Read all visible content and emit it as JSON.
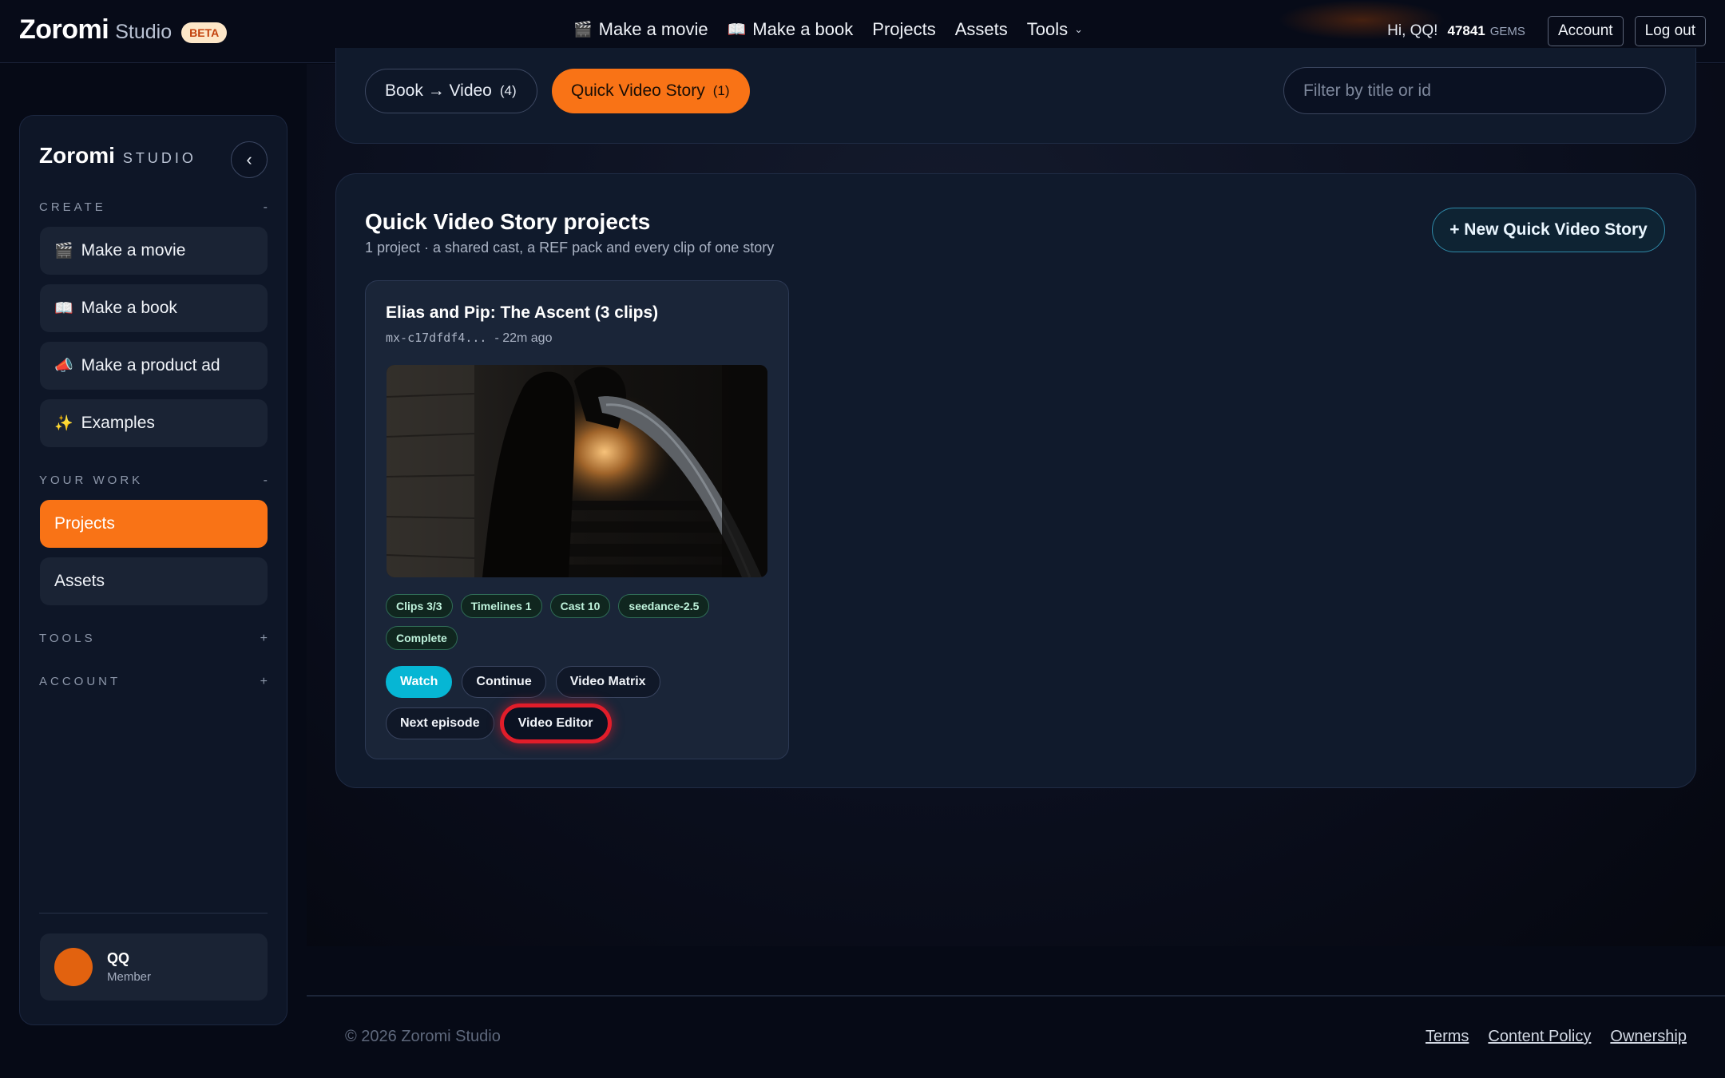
{
  "header": {
    "brand": "Zoromi",
    "brand_sub": "Studio",
    "beta": "BETA",
    "nav": [
      {
        "label": "Make a movie",
        "icon": "🎬"
      },
      {
        "label": "Make a book",
        "icon": "📖"
      },
      {
        "label": "Projects"
      },
      {
        "label": "Assets"
      },
      {
        "label": "Tools"
      }
    ],
    "greeting": "Hi, QQ!",
    "gems_count": "47841",
    "gems_label": "GEMS",
    "account_label": "Account",
    "logout_label": "Log out"
  },
  "sidebar": {
    "brand": "Zoromi",
    "studio": "STUDIO",
    "collapse_icon": "‹",
    "sections": {
      "create": {
        "label": "CREATE",
        "toggle": "-"
      },
      "your_work": {
        "label": "YOUR WORK",
        "toggle": "-"
      },
      "tools": {
        "label": "TOOLS",
        "toggle": "+"
      },
      "account": {
        "label": "ACCOUNT",
        "toggle": "+"
      }
    },
    "create_items": [
      {
        "label": "Make a movie",
        "icon": "🎬"
      },
      {
        "label": "Make a book",
        "icon": "📖"
      },
      {
        "label": "Make a product ad",
        "icon": "📣"
      },
      {
        "label": "Examples",
        "icon": "✨"
      }
    ],
    "work_items": [
      {
        "label": "Projects"
      },
      {
        "label": "Assets"
      }
    ],
    "user": {
      "name": "QQ",
      "role": "Member"
    }
  },
  "filters": {
    "tabs": [
      {
        "label": "Book → Video",
        "count": "(4)"
      },
      {
        "label": "Quick Video Story",
        "count": "(1)"
      }
    ],
    "search_placeholder": "Filter by title or id"
  },
  "projects": {
    "title": "Quick Video Story projects",
    "subtitle": "1 project · a shared cast, a REF pack and every clip of one story",
    "new_button": "+ New Quick Video Story",
    "card": {
      "title": "Elias and Pip: The Ascent (3 clips)",
      "id": "mx-c17dfdf4...",
      "time": "- 22m ago",
      "chips": [
        "Clips 3/3",
        "Timelines 1",
        "Cast 10",
        "seedance-2.5",
        "Complete"
      ],
      "actions": [
        "Watch",
        "Continue",
        "Video Matrix",
        "Next episode",
        "Video Editor"
      ]
    }
  },
  "footer": {
    "copyright": "© 2026 Zoromi Studio",
    "links": [
      "Terms",
      "Content Policy",
      "Ownership"
    ]
  },
  "colors": {
    "accent": "#f97316",
    "watch": "#06b6d4",
    "highlight_ring": "#e11d2a",
    "chip_text": "#bff3dc"
  }
}
